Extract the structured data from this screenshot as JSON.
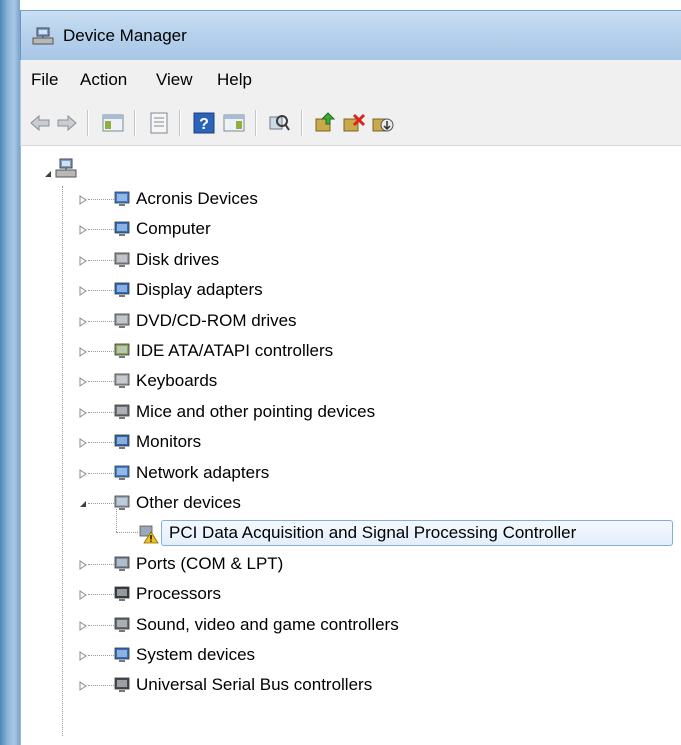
{
  "window": {
    "title": "Device Manager"
  },
  "menu": [
    "File",
    "Action",
    "View",
    "Help"
  ],
  "toolbar": {
    "buttons": [
      "back-icon",
      "forward-icon",
      "show-hide-tree-icon",
      "properties-icon",
      "help-icon",
      "action-pane-icon",
      "scan-hardware-icon",
      "update-driver-icon",
      "uninstall-icon",
      "disable-icon"
    ]
  },
  "tree": {
    "root": {
      "icon": "computer-root-icon",
      "expanded": true
    },
    "categories": [
      {
        "label": "Acronis Devices",
        "icon": "network-device-icon",
        "expanded": false
      },
      {
        "label": "Computer",
        "icon": "computer-icon",
        "expanded": false
      },
      {
        "label": "Disk drives",
        "icon": "disk-drive-icon",
        "expanded": false
      },
      {
        "label": "Display adapters",
        "icon": "display-adapter-icon",
        "expanded": false
      },
      {
        "label": "DVD/CD-ROM drives",
        "icon": "dvd-drive-icon",
        "expanded": false
      },
      {
        "label": "IDE ATA/ATAPI controllers",
        "icon": "ide-controller-icon",
        "expanded": false
      },
      {
        "label": "Keyboards",
        "icon": "keyboard-icon",
        "expanded": false
      },
      {
        "label": "Mice and other pointing devices",
        "icon": "mouse-icon",
        "expanded": false
      },
      {
        "label": "Monitors",
        "icon": "monitor-icon",
        "expanded": false
      },
      {
        "label": "Network adapters",
        "icon": "network-adapter-icon",
        "expanded": false
      },
      {
        "label": "Other devices",
        "icon": "unknown-device-icon",
        "expanded": true,
        "children": [
          {
            "label": "PCI Data Acquisition and Signal Processing Controller",
            "icon": "warning-device-icon",
            "selected": true
          }
        ]
      },
      {
        "label": "Ports (COM & LPT)",
        "icon": "port-icon",
        "expanded": false
      },
      {
        "label": "Processors",
        "icon": "processor-icon",
        "expanded": false
      },
      {
        "label": "Sound, video and game controllers",
        "icon": "sound-icon",
        "expanded": false
      },
      {
        "label": "System devices",
        "icon": "system-device-icon",
        "expanded": false
      },
      {
        "label": "Universal Serial Bus controllers",
        "icon": "usb-icon",
        "expanded": false
      }
    ]
  },
  "colors": {
    "selection_border": "#84acdd",
    "titlebar": "#b7d2ec",
    "warning": "#f2c21c"
  }
}
